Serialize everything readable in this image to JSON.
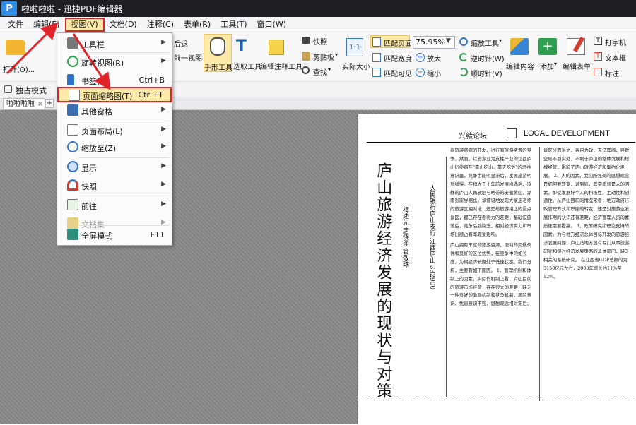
{
  "window": {
    "title": "啦啦啦啦 - 迅捷PDF编辑器",
    "logo": "P"
  },
  "menubar": {
    "items": [
      "文件",
      "编辑(E)",
      "视图(V)",
      "文档(D)",
      "注释(C)",
      "表单(R)",
      "工具(T)",
      "窗口(W)"
    ]
  },
  "ribbon": {
    "open_label": "打开(O)...",
    "partial_labels": [
      "后退",
      "前一视图"
    ],
    "hand_tool": "手形工具",
    "select_tool": "选取工具",
    "edit_annotation_tool": "编辑注释工具",
    "snapshot": "快照",
    "clipboard": "剪贴板",
    "find": "查找",
    "actual_size": "实际大小",
    "fit_page": "匹配页面",
    "fit_width": "匹配宽度",
    "fit_visible": "匹配可见",
    "zoom_value": "75.95%",
    "zoom_tool": "缩放工具",
    "zoom_in": "放大",
    "zoom_out": "缩小",
    "rotate_ccw": "逆时针(W)",
    "rotate_cw": "顺时针(V)",
    "edit_content": "编辑内容",
    "add": "添加",
    "edit_form": "编辑表单",
    "typewriter": "打字机",
    "textbox": "文本框",
    "annotate": "标注",
    "solo_mode": "独占模式"
  },
  "tab": {
    "doc_name": "啦啦啦啦",
    "close": "×"
  },
  "dropdown": {
    "items": [
      {
        "label": "工具栏",
        "shortcut": "",
        "submenu": true
      },
      {
        "label": "旋转视图(R)",
        "shortcut": "",
        "submenu": true
      },
      {
        "label": "书签(B)",
        "shortcut": "Ctrl+B",
        "submenu": false
      },
      {
        "label": "页面缩略图(T)",
        "shortcut": "Ctrl+T",
        "submenu": false
      },
      {
        "label": "其他窗格",
        "shortcut": "",
        "submenu": true
      },
      {
        "label": "页面布局(L)",
        "shortcut": "",
        "submenu": true
      },
      {
        "label": "缩放至(Z)",
        "shortcut": "",
        "submenu": true
      },
      {
        "label": "显示",
        "shortcut": "",
        "submenu": true
      },
      {
        "label": "快照",
        "shortcut": "",
        "submenu": true
      },
      {
        "label": "前往",
        "shortcut": "",
        "submenu": true
      },
      {
        "label": "文档集",
        "shortcut": "",
        "submenu": true
      },
      {
        "label": "全屏模式",
        "shortcut": "F11",
        "submenu": false
      }
    ]
  },
  "document": {
    "header_cn": "兴赣论坛",
    "header_en": "LOCAL DEVELOPMENT",
    "title": "庐山旅游经济发展的现状与对策",
    "authors": "梅述先 唐饶萍 管敬球",
    "affiliation": "人民银行庐山支行 江西庐山 332900",
    "col1": "看旅游资源的开发，进行有旅游资源的竞争。然而，以旅游业为支柱产业的江西庐山仍停留在\"靠山吃山，靠天吃饭\"的思维意识里，竞争手段明显滞后，发展旅游明显缓慢。在稍大于十年前发展机遇后，冷静的庐山人再放眼与略带的安徽黄山、湖南张家界相比，却惊讶地发现大家走老师的旅游区相对地；还是与旅游相比的景点景区，都已存在看得力的差距，基础设施落后，竞争后劲缺乏，相对经济实力和市场份额占有率颇受影响。",
    "col2": "庐山拥有丰富的旅游资源，便利的交通条件和良好的区位优势，在竞争中的如长度，为何经济长期处于低速状态，我们分析，主要有如下原因。 1、管理机制和体制上的因素，实际作机制上看，庐山目前的旅游市场经营，存在很大的差距，缺乏一种良好的激励机制和竞争机制，风险意识、忧患意识不强，思想观念相对滞后。",
    "col3": "景区分而治之，各自为政，无法理顺，导致全局不到实处，不利于庐山的整体发展和规模经营，影响了庐山旅游经济和集约化发展。 2、人的因素。我们所强调的思想观念是如何要转变，说到底，其实质就是人的因素。即使发展好个人的积极性、主动性和创造性。从庐山目前的情况来看，地方政府行政管理方式和职能的转变，还是对旅游业发展作用的认识还有差距，经济管理人员的素质还需要提高。 3、政策研究和理论支持的因素。为与地方经济总体目标开发的旅游经济发展问题，庐山乃地方没有专门从事旅游研究和探讨经济发展策略的具体部门，缺乏相关的系统研究。 在江西省GDP总额的为3150亿元左右，2003年增长约11%至12%。"
  }
}
